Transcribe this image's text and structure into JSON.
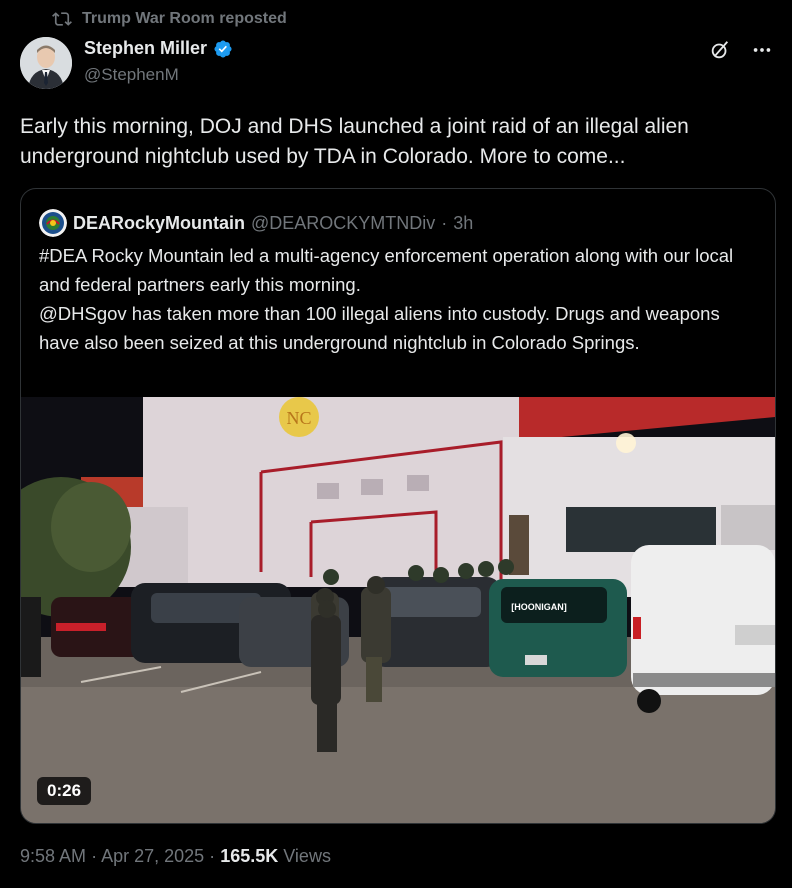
{
  "repost": {
    "text": "Trump War Room reposted",
    "icon": "repost-icon"
  },
  "author": {
    "name": "Stephen Miller",
    "handle": "@StephenM",
    "verified": true,
    "avatar_icon": "avatar"
  },
  "tweet": {
    "text": "Early this morning, DOJ and DHS launched a joint raid of an illegal alien underground nightclub used by TDA in Colorado. More to come..."
  },
  "quote": {
    "name": "DEARockyMountain",
    "handle": "@DEAROCKYMTNDiv",
    "separator": "·",
    "time": "3h",
    "paragraphs": [
      "#DEA Rocky Mountain led a multi-agency enforcement operation along with our local and federal partners early this morning.",
      "@DHSgov has taken more than 100 illegal aliens into custody. Drugs and weapons have also been seized at this underground nightclub in Colorado Springs."
    ],
    "media": {
      "duration": "0:26",
      "sign_text": "[HOONIGAN]",
      "building_logo": "NC"
    }
  },
  "meta": {
    "time": "9:58 AM",
    "date": "Apr 27, 2025",
    "separator": "·",
    "views_count": "165.5K",
    "views_label": "Views"
  },
  "colors": {
    "background": "#000000",
    "text": "#e7e9ea",
    "muted": "#71767b",
    "verified": "#1d9bf0",
    "border": "#2f3336"
  }
}
